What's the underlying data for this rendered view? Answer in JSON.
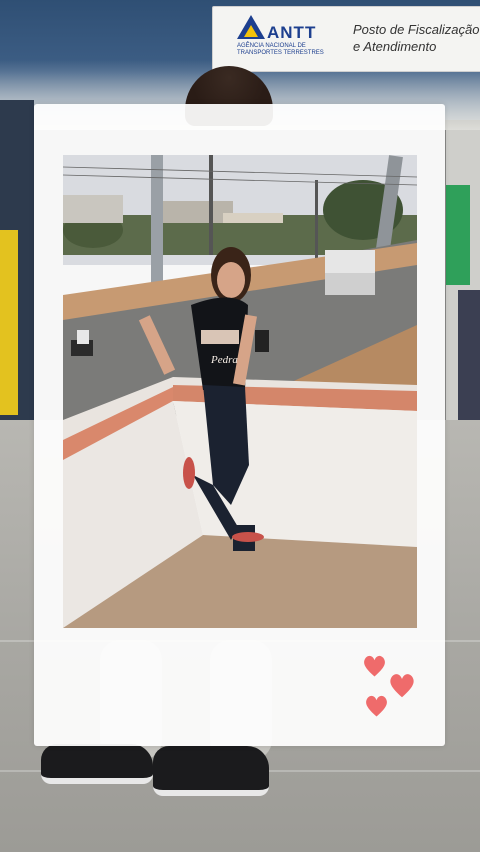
{
  "sign": {
    "brand": "ANTT",
    "agency": "AGÊNCIA NACIONAL DE TRANSPORTES TERRESTRES",
    "line1": "Posto de Fiscalização",
    "line2": "e Atendimento"
  },
  "shirt_text": "Pedra",
  "colors": {
    "frame": "#ffffff",
    "heart": "#ef6b6b",
    "sign_blue": "#1d3f8f",
    "sign_yellow": "#f3c20a"
  },
  "icons": [
    "heart-icon",
    "heart-icon",
    "heart-icon",
    "antt-logo-icon"
  ]
}
